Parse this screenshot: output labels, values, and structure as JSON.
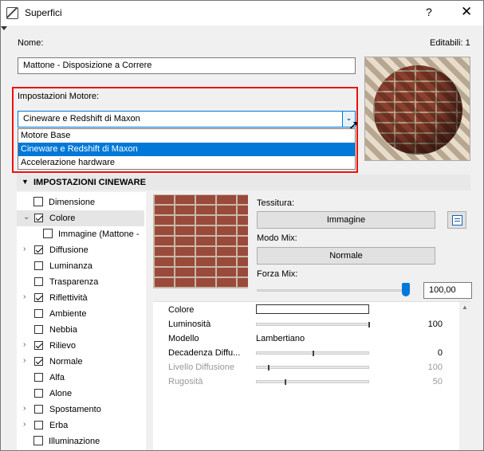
{
  "window": {
    "title": "Superfici",
    "help": "?",
    "close": "✕"
  },
  "nome": {
    "label": "Nome:",
    "value": "Mattone - Disposizione a Correre",
    "editabili": "Editabili: 1"
  },
  "engine": {
    "label": "Impostazioni Motore:",
    "selected": "Cineware e Redshift di Maxon",
    "options": [
      "Motore Base",
      "Cineware e Redshift di Maxon",
      "Accelerazione hardware"
    ]
  },
  "section": {
    "title": "IMPOSTAZIONI CINEWARE"
  },
  "tree": [
    {
      "label": "Dimensione",
      "checked": null,
      "icon": "dimension-icon"
    },
    {
      "label": "Colore",
      "checked": true,
      "expanded": true,
      "selected": true
    },
    {
      "label": "Immagine (Mattone -",
      "checked": null,
      "icon": "image-icon"
    },
    {
      "label": "Diffusione",
      "checked": true,
      "expandable": true
    },
    {
      "label": "Luminanza",
      "checked": false
    },
    {
      "label": "Trasparenza",
      "checked": false
    },
    {
      "label": "Riflettività",
      "checked": true,
      "expandable": true
    },
    {
      "label": "Ambiente",
      "checked": false
    },
    {
      "label": "Nebbia",
      "checked": false
    },
    {
      "label": "Rilievo",
      "checked": true,
      "expandable": true
    },
    {
      "label": "Normale",
      "checked": true,
      "expandable": true
    },
    {
      "label": "Alfa",
      "checked": false
    },
    {
      "label": "Alone",
      "checked": false
    },
    {
      "label": "Spostamento",
      "checked": false,
      "expandable": true
    },
    {
      "label": "Erba",
      "checked": false,
      "expandable": true
    },
    {
      "label": "Illuminazione",
      "checked": null,
      "icon": "lighting-icon"
    }
  ],
  "texture": {
    "label": "Tessitura:",
    "button": "Immagine"
  },
  "mix": {
    "label": "Modo Mix:",
    "button": "Normale"
  },
  "forza": {
    "label": "Forza Mix:",
    "value": "100,00",
    "level": 1.0
  },
  "props": [
    {
      "name": "Colore",
      "kind": "color",
      "color": "#ffffff"
    },
    {
      "name": "Luminosità",
      "kind": "slider",
      "level": 1.0,
      "value": "100"
    },
    {
      "name": "Modello",
      "kind": "text",
      "value": "Lambertiano"
    },
    {
      "name": "Decadenza Diffu...",
      "kind": "slider",
      "level": 0.5,
      "value": "0"
    },
    {
      "name": "Livello Diffusione",
      "kind": "slider",
      "level": 0.1,
      "value": "100",
      "disabled": true
    },
    {
      "name": "Rugosità",
      "kind": "slider",
      "level": 0.25,
      "value": "50",
      "disabled": true
    }
  ]
}
